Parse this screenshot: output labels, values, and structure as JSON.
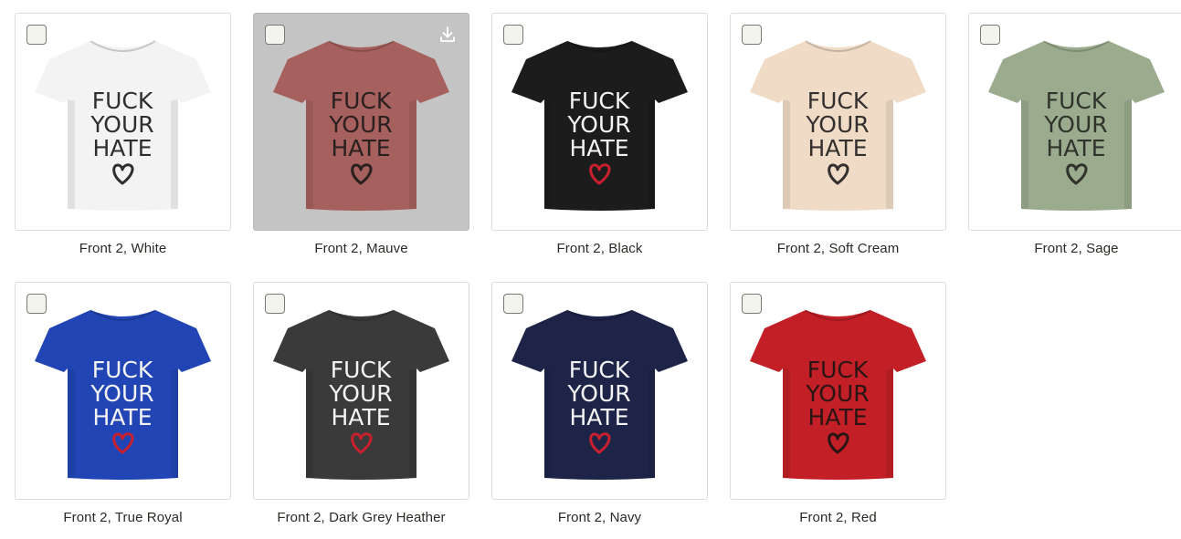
{
  "products": [
    {
      "label": "Front 2, White",
      "color": "#f3f3f3",
      "ink": "#2e2e2e",
      "heart": "#2e2e2e",
      "hovered": false
    },
    {
      "label": "Front 2, Mauve",
      "color": "#a6605d",
      "ink": "#2a2020",
      "heart": "#2a2020",
      "hovered": true
    },
    {
      "label": "Front 2, Black",
      "color": "#1c1c1c",
      "ink": "#f4f4f4",
      "heart": "#c8202e",
      "hovered": false
    },
    {
      "label": "Front 2, Soft Cream",
      "color": "#f0dcc6",
      "ink": "#343030",
      "heart": "#343030",
      "hovered": false
    },
    {
      "label": "Front 2, Sage",
      "color": "#9aab8e",
      "ink": "#2f332c",
      "heart": "#2f332c",
      "hovered": false
    },
    {
      "label": "Front 2, True Royal",
      "color": "#2145b5",
      "ink": "#f4f4f4",
      "heart": "#c8202e",
      "hovered": false
    },
    {
      "label": "Front 2, Dark Grey Heather",
      "color": "#3a3a3a",
      "ink": "#f4f4f4",
      "heart": "#c8202e",
      "hovered": false
    },
    {
      "label": "Front 2, Navy",
      "color": "#1d2448",
      "ink": "#f4f4f4",
      "heart": "#c8202e",
      "hovered": false
    },
    {
      "label": "Front 2, Red",
      "color": "#c21f27",
      "ink": "#2a1414",
      "heart": "#2a1414",
      "hovered": false
    }
  ],
  "print_text": {
    "line1": "FUCK",
    "line2": "YOUR",
    "line3": "HATE"
  },
  "icons": {
    "download": "download-icon",
    "checkbox": "checkbox"
  }
}
